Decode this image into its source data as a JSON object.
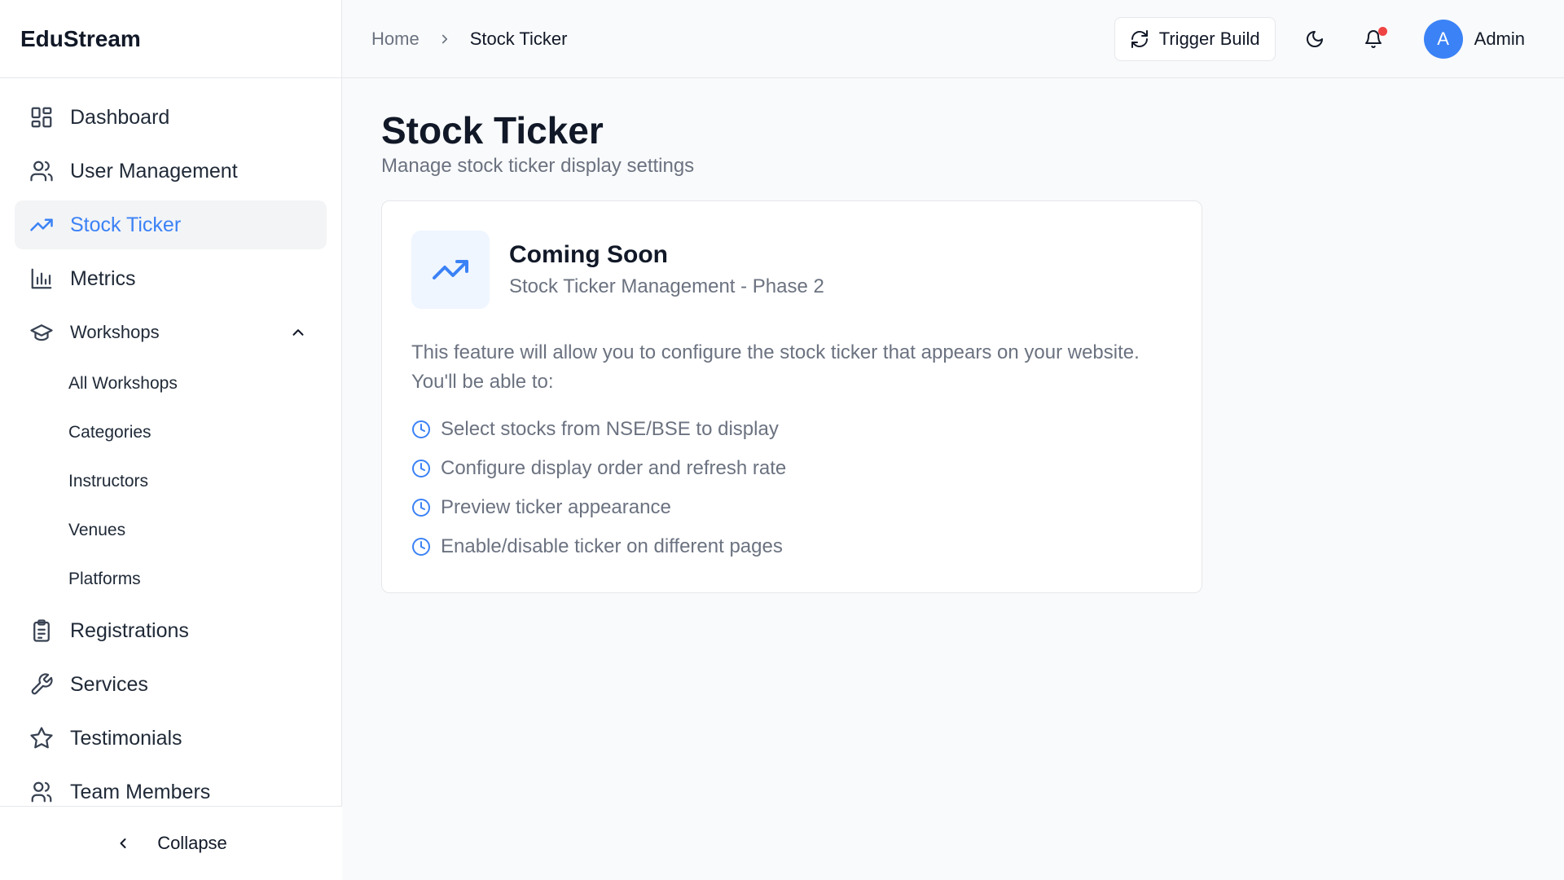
{
  "app": {
    "brand": "EduStream"
  },
  "sidebar": {
    "items": [
      {
        "label": "Dashboard",
        "icon": "layout-grid-icon"
      },
      {
        "label": "User Management",
        "icon": "users-icon"
      },
      {
        "label": "Stock Ticker",
        "icon": "trending-up-icon",
        "active": true
      },
      {
        "label": "Metrics",
        "icon": "bar-chart-icon"
      }
    ],
    "workshops": {
      "label": "Workshops",
      "icon": "graduation-cap-icon",
      "expanded": true,
      "children": [
        "All Workshops",
        "Categories",
        "Instructors",
        "Venues",
        "Platforms"
      ]
    },
    "items_after": [
      {
        "label": "Registrations",
        "icon": "clipboard-list-icon"
      },
      {
        "label": "Services",
        "icon": "wrench-icon"
      },
      {
        "label": "Testimonials",
        "icon": "star-icon"
      },
      {
        "label": "Team Members",
        "icon": "user-group-icon"
      }
    ],
    "collapse_label": "Collapse"
  },
  "header": {
    "breadcrumb": [
      "Home",
      "Stock Ticker"
    ],
    "trigger_build_label": "Trigger Build",
    "notification_dot_color": "#ef4444",
    "user": {
      "initial": "A",
      "name": "Admin",
      "avatar_color": "#3b82f6"
    }
  },
  "main": {
    "title": "Stock Ticker",
    "subtitle": "Manage stock ticker display settings",
    "card": {
      "title": "Coming Soon",
      "subtitle": "Stock Ticker Management - Phase 2",
      "description": "This feature will allow you to configure the stock ticker that appears on your website. You'll be able to:",
      "features": [
        "Select stocks from NSE/BSE to display",
        "Configure display order and refresh rate",
        "Preview ticker appearance",
        "Enable/disable ticker on different pages"
      ]
    }
  },
  "colors": {
    "accent": "#3b82f6",
    "active_bg": "#f3f4f6",
    "muted_text": "#6b7280"
  }
}
